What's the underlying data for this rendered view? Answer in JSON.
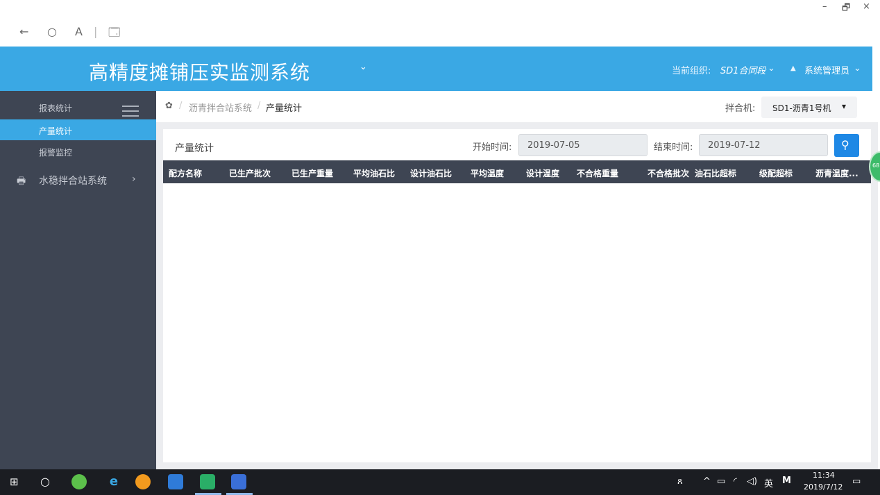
{
  "window": {
    "minimize": "–",
    "restore": "🗗",
    "close": "×",
    "nav_back": "←",
    "nav_refresh": "○",
    "nav_reader": "A",
    "nav_divider": "|",
    "nav_window": "🗔"
  },
  "header": {
    "app_title": "高精度摊铺压实监测系统",
    "title_chevron": "⌄",
    "org_label": "当前组织:",
    "org_value": "SD1合同段",
    "org_chevron": "⌄",
    "user_icon": "▲",
    "user_name": "系统管理员",
    "user_chevron": "⌄"
  },
  "sidebar": {
    "items": [
      {
        "label": "报表统计"
      },
      {
        "label": "产量统计"
      },
      {
        "label": "报警监控"
      }
    ],
    "group": {
      "label": "水稳拌合站系统",
      "chevron": "›"
    }
  },
  "breadcrumb": {
    "home_icon": "✿",
    "sep1": "/",
    "level1": "沥青拌合站系统",
    "sep2": "/",
    "current": "产量统计"
  },
  "mixer": {
    "label": "拌合机:",
    "selected": "SD1-沥青1号机",
    "chevron": "▾"
  },
  "panel": {
    "title": "产量统计",
    "start_label": "开始时间:",
    "start_value": "2019-07-05",
    "end_label": "结束时间:",
    "end_value": "2019-07-12",
    "search_icon": "⚲"
  },
  "table": {
    "columns": [
      "配方名称",
      "已生产批次",
      "已生产重量",
      "平均油石比",
      "设计油石比",
      "平均温度",
      "设计温度",
      "不合格重量",
      "不合格批次",
      "油石比超标",
      "级配超标",
      "沥青温度..."
    ],
    "rows": []
  },
  "badge": {
    "value": "68"
  },
  "taskbar": {
    "start_icon": "⊞",
    "search_icon": "○",
    "tray_person": "ጸ",
    "tray_up": "^",
    "tray_battery": "▭",
    "tray_wifi": "◜",
    "tray_volume": "◁)",
    "ime": "英",
    "ime_mode": "M",
    "time": "11:34",
    "date": "2019/7/12",
    "notify_icon": "▭"
  },
  "colors": {
    "header_bg": "#3aa8e4",
    "sidebar_bg": "#3e4553",
    "active_item": "#3aa8e4",
    "search_button": "#1e88e5",
    "table_header": "#3e4553"
  }
}
